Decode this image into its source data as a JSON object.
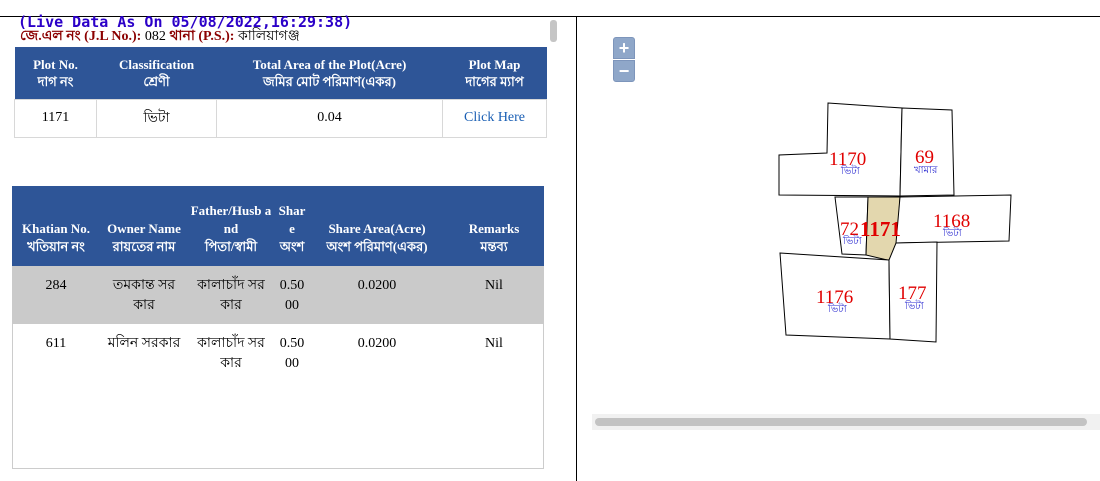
{
  "header": {
    "live_data": "(Live Data As On 05/08/2022,16:29:38)",
    "jl_label": "জে.এল নং (J.L No.):",
    "jl_value": "082",
    "ps_label": "থানা (P.S.):",
    "ps_value": "কালিয়াগঞ্জ"
  },
  "plot_table": {
    "headers": [
      {
        "en": "Plot No.",
        "bn": "দাগ নং"
      },
      {
        "en": "Classification",
        "bn": "শ্রেণী"
      },
      {
        "en": "Total Area of the Plot(Acre)",
        "bn": "জমির মোট পরিমাণ(একর)"
      },
      {
        "en": "Plot Map",
        "bn": "দাগের ম্যাপ"
      }
    ],
    "row": {
      "plot_no": "1171",
      "classification": "ভিটা",
      "total_area": "0.04",
      "map_link": "Click Here"
    }
  },
  "owner_table": {
    "headers": [
      {
        "en": "Khatian No.",
        "bn": "খতিয়ান নং"
      },
      {
        "en": "Owner Name",
        "bn": "রায়তের নাম"
      },
      {
        "en": "Father/Husb and",
        "bn": "পিতা/স্বামী"
      },
      {
        "en": "Share",
        "bn": "অংশ"
      },
      {
        "en": "Share Area(Acre)",
        "bn": "অংশ পরিমাণ(একর)"
      },
      {
        "en": "Remarks",
        "bn": "মন্তব্য"
      }
    ],
    "rows": [
      {
        "khatian": "284",
        "owner": "তমকান্ত সরকার",
        "father": "কালাচাঁদ সরকার",
        "share": "0.5000",
        "share_area": "0.0200",
        "remarks": "Nil"
      },
      {
        "khatian": "611",
        "owner": "মলিন সরকার",
        "father": "কালাচাঁদ সরকার",
        "share": "0.5000",
        "share_area": "0.0200",
        "remarks": "Nil"
      }
    ]
  },
  "map": {
    "zoom_in": "+",
    "zoom_out": "−",
    "highlight_color": "#e3d7ae",
    "label_color": "#e00000",
    "sub_label_color": "#2a2ad0",
    "parcels": [
      {
        "id": "1170",
        "land_type": "ভিটা"
      },
      {
        "id": "69",
        "land_type": "খামার"
      },
      {
        "id": "72",
        "land_type": "ভিটা"
      },
      {
        "id": "1171",
        "land_type": ""
      },
      {
        "id": "1168",
        "land_type": "ভিটা"
      },
      {
        "id": "1176",
        "land_type": "ভিটা"
      },
      {
        "id": "177",
        "land_type": "ভিটা"
      }
    ]
  }
}
